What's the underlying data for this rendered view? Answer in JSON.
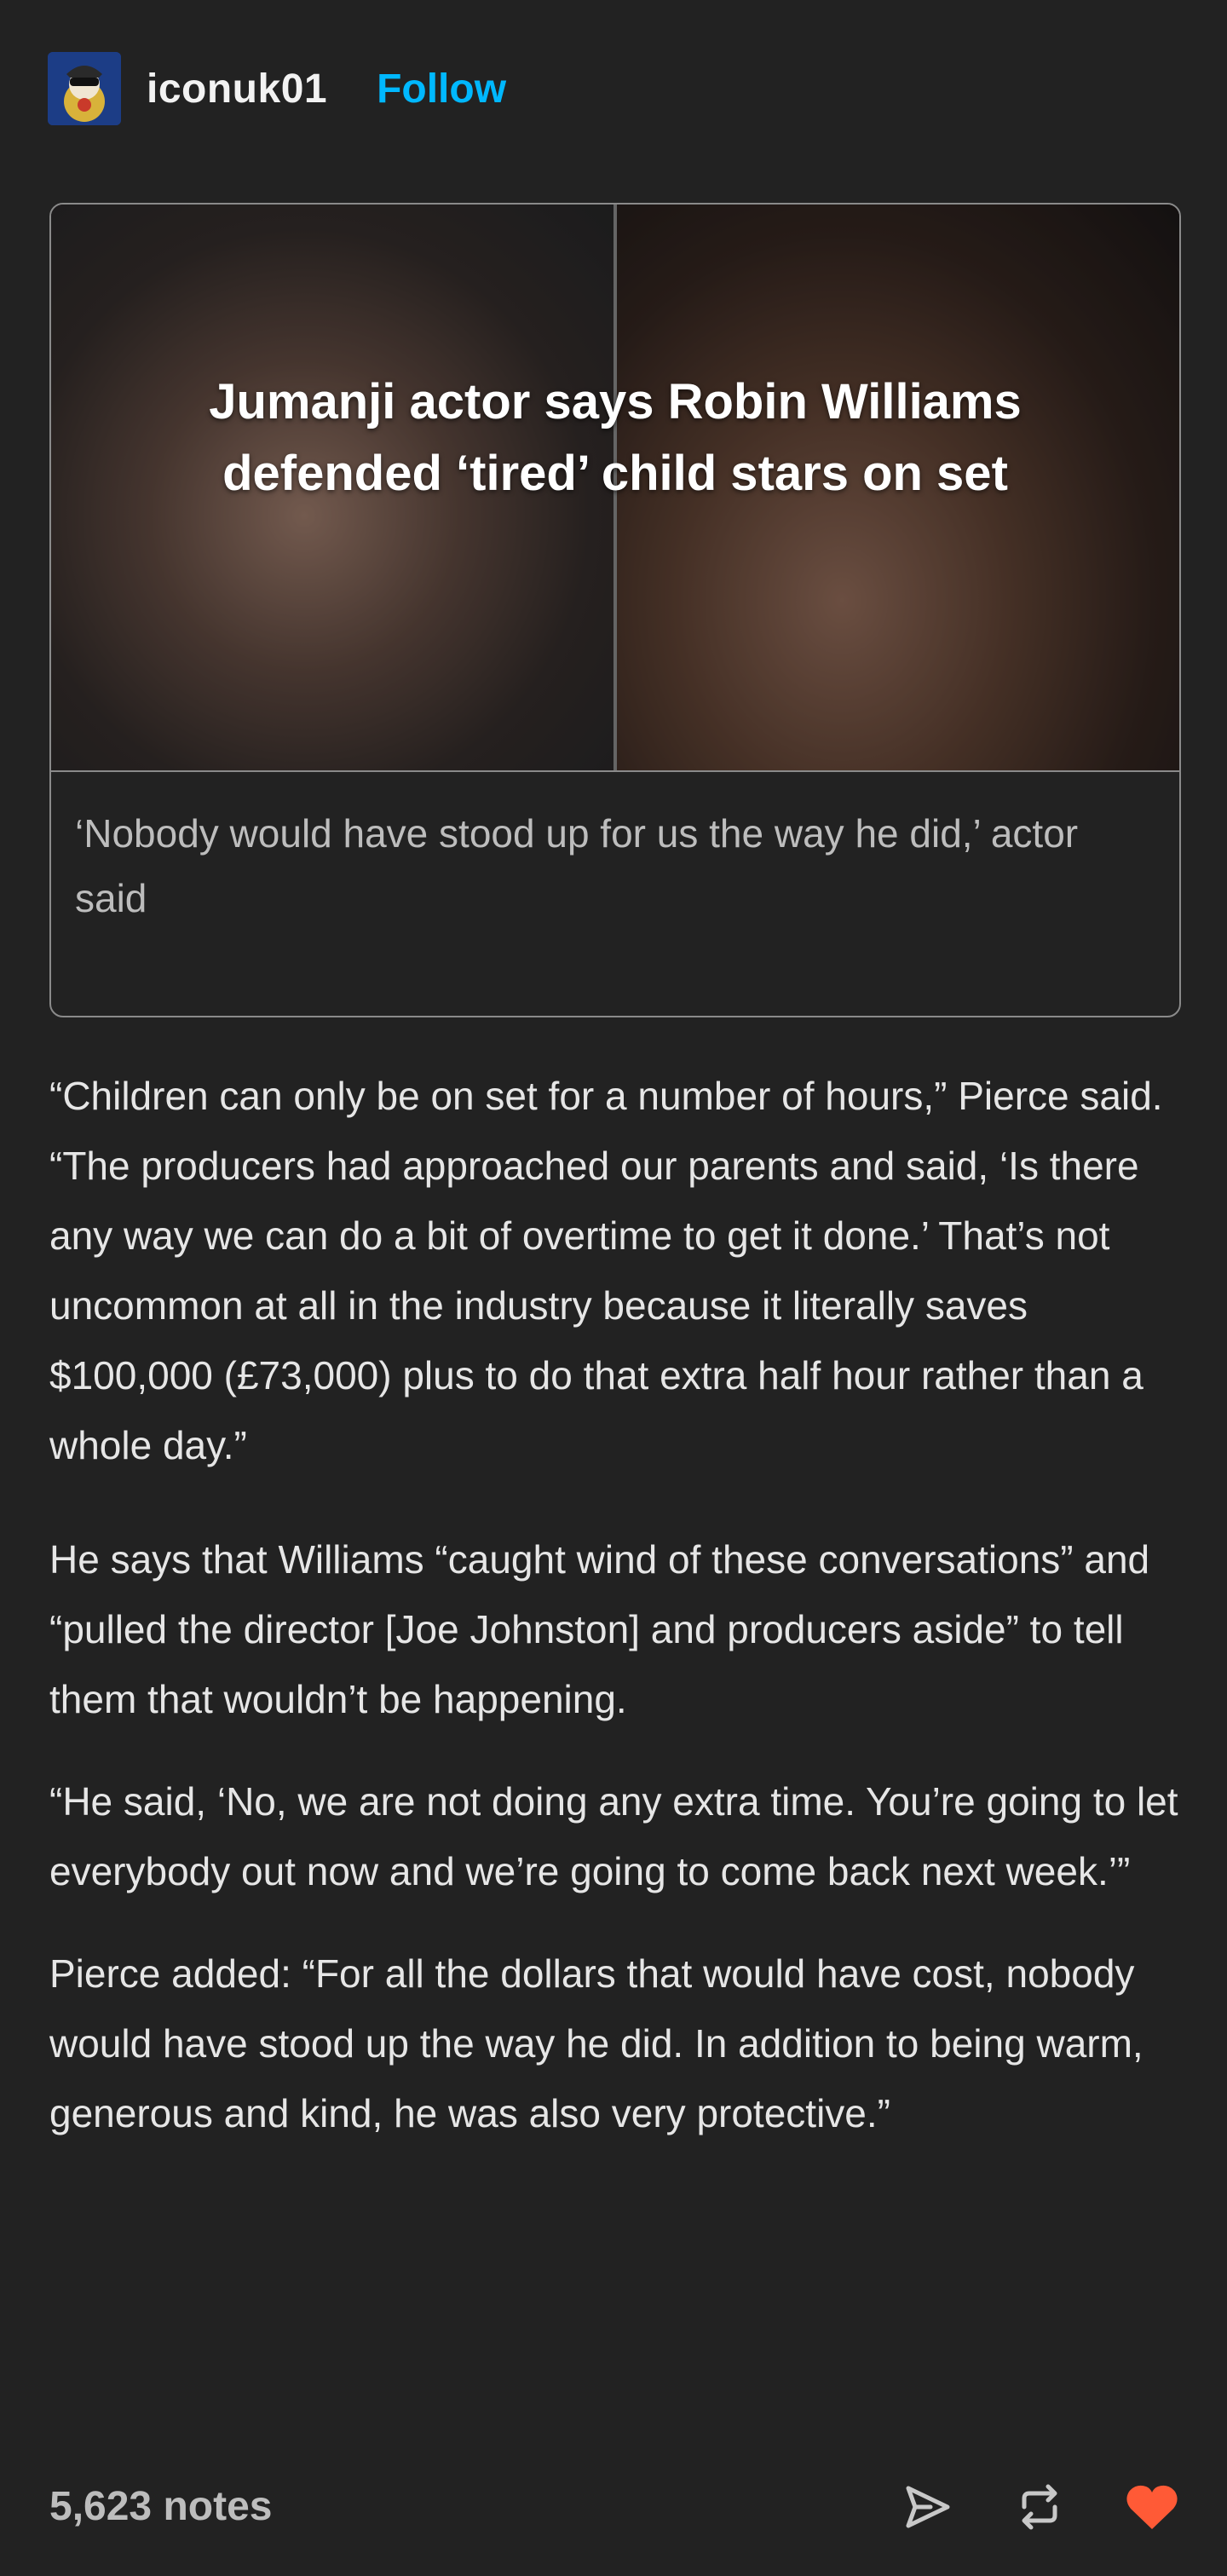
{
  "post": {
    "username": "iconuk01",
    "follow_label": "Follow",
    "avatar_icon": "avatar-icon",
    "link_card": {
      "title": "Jumanji actor says Robin Williams defended ‘tired’ child stars on set",
      "description": "‘Nobody would have stood up for us the way he did,’ actor said"
    },
    "paragraphs": [
      "“Children can only be on set for a number of hours,” Pierce said. “The producers had approached our parents and said, ‘Is there any way we can do a bit of overtime to get it done.’ That’s not uncommon at all in the industry because it literally saves $100,000 (£73,000) plus to do that extra half hour rather than a whole day.”",
      "He says that Williams “caught wind of these conversations” and “pulled the director [Joe Johnston] and producers aside” to tell them that wouldn’t be happening.",
      "“He said, ‘No, we are not doing any extra time. You’re going to let everybody out now and we’re going to come back next week.’”",
      "Pierce added: “For all the dollars that would have cost, nobody would have stood up the way he did. In addition to being warm, generous and kind, he was also very protective.”"
    ],
    "notes": "5,623 notes",
    "actions": {
      "share_icon": "share-icon",
      "reblog_icon": "reblog-icon",
      "like_icon": "heart-icon"
    },
    "colors": {
      "background": "#222222",
      "follow": "#00b8ff",
      "like": "#ff5a36"
    }
  }
}
